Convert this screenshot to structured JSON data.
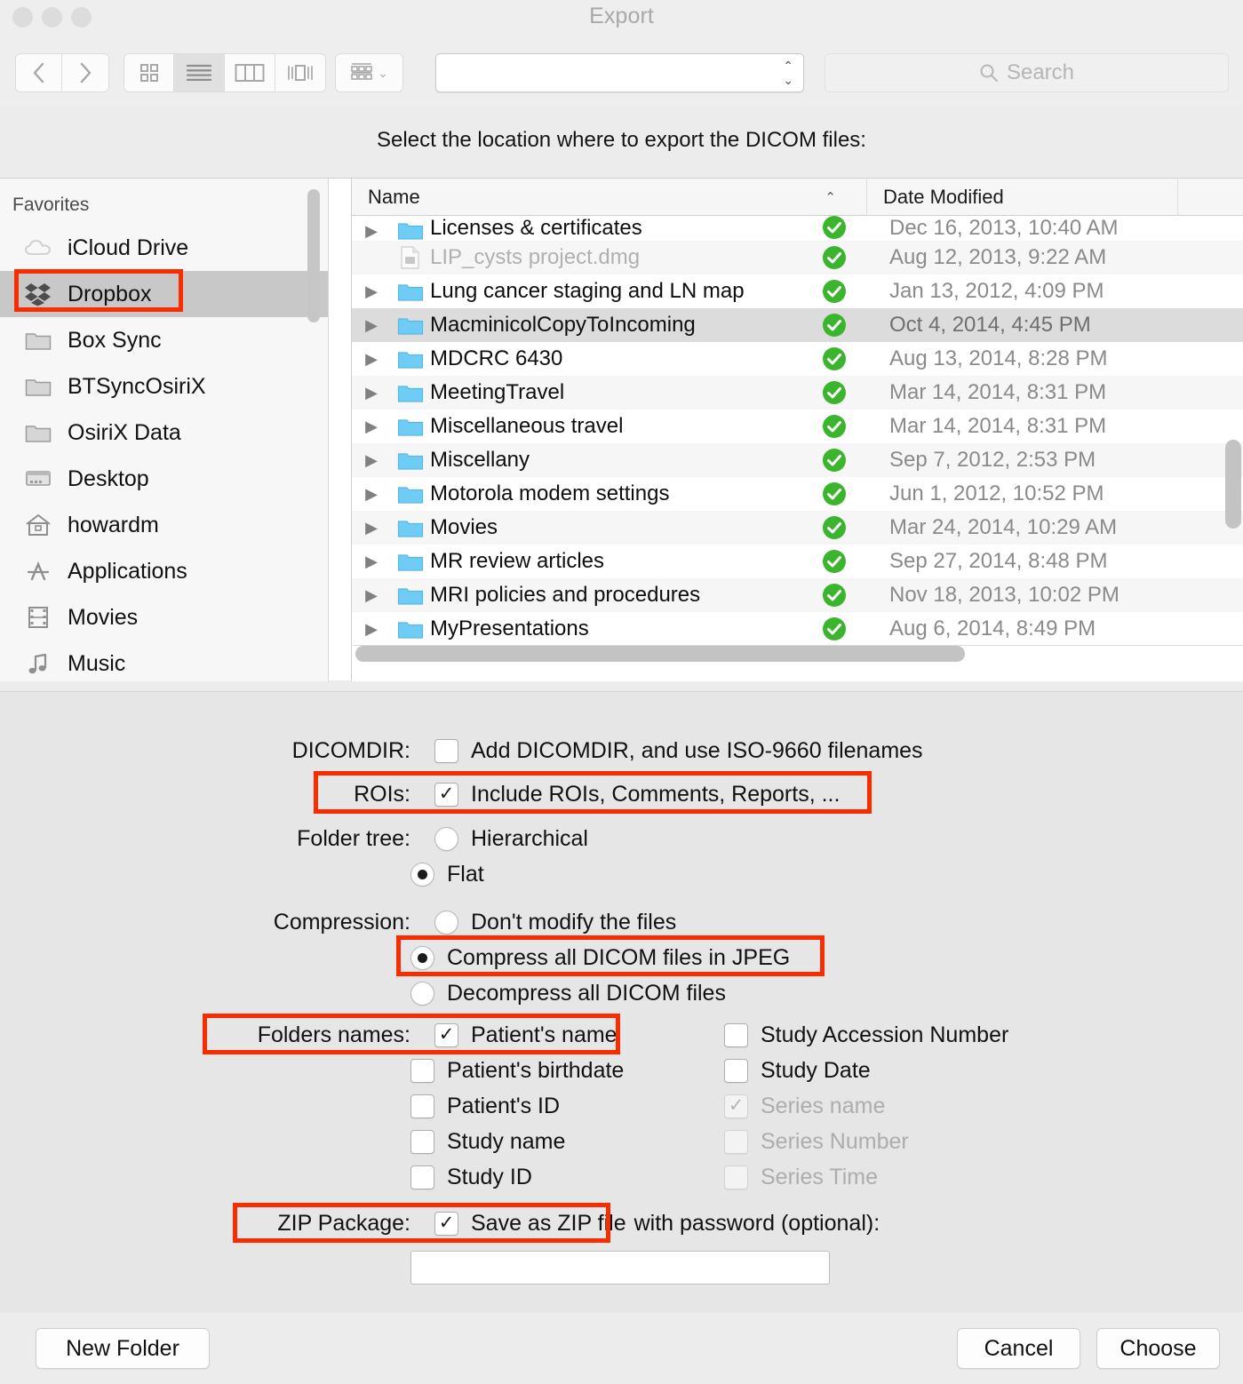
{
  "window": {
    "title": "Export"
  },
  "toolbar": {
    "back_icon": "back-chevron-icon",
    "forward_icon": "forward-chevron-icon",
    "view_icon_grid": "icon-view-icon",
    "view_list": "list-view-icon",
    "view_column": "column-view-icon",
    "view_coverflow": "coverflow-view-icon",
    "arrange_icon": "arrange-by-icon",
    "path_combo_value": "",
    "search_placeholder": "Search",
    "search_icon": "search-icon"
  },
  "prompt": {
    "text": "Select the location where to export the DICOM files:"
  },
  "sidebar": {
    "header": "Favorites",
    "items": [
      {
        "label": "iCloud Drive",
        "icon": "icloud-icon",
        "selected": false
      },
      {
        "label": "Dropbox",
        "icon": "dropbox-icon",
        "selected": true
      },
      {
        "label": "Box Sync",
        "icon": "folder-icon",
        "selected": false
      },
      {
        "label": "BTSyncOsiriX",
        "icon": "folder-icon",
        "selected": false
      },
      {
        "label": "OsiriX Data",
        "icon": "folder-icon",
        "selected": false
      },
      {
        "label": "Desktop",
        "icon": "desktop-icon",
        "selected": false
      },
      {
        "label": "howardm",
        "icon": "home-icon",
        "selected": false
      },
      {
        "label": "Applications",
        "icon": "applications-icon",
        "selected": false
      },
      {
        "label": "Movies",
        "icon": "movies-icon",
        "selected": false
      },
      {
        "label": "Music",
        "icon": "music-icon",
        "selected": false
      }
    ]
  },
  "filelist": {
    "columns": [
      "Name",
      "Date Modified"
    ],
    "sort_indicator": "sort-ascending-icon",
    "rows": [
      {
        "name": "Licenses & certificates",
        "date": "Dec 16, 2013, 10:40 AM",
        "icon": "folder-icon",
        "selected": false,
        "dim": false,
        "clipped": true
      },
      {
        "name": "LIP_cysts project.dmg",
        "date": "Aug 12, 2013, 9:22 AM",
        "icon": "disk-image-icon",
        "selected": false,
        "dim": true,
        "clipped": false
      },
      {
        "name": "Lung cancer staging and LN map",
        "date": "Jan 13, 2012, 4:09 PM",
        "icon": "folder-icon",
        "selected": false,
        "dim": false,
        "clipped": false
      },
      {
        "name": "MacminicolCopyToIncoming",
        "date": "Oct 4, 2014, 4:45 PM",
        "icon": "folder-icon",
        "selected": true,
        "dim": false,
        "clipped": false
      },
      {
        "name": "MDCRC 6430",
        "date": "Aug 13, 2014, 8:28 PM",
        "icon": "folder-icon",
        "selected": false,
        "dim": false,
        "clipped": false
      },
      {
        "name": "MeetingTravel",
        "date": "Mar 14, 2014, 8:31 PM",
        "icon": "folder-icon",
        "selected": false,
        "dim": false,
        "clipped": false
      },
      {
        "name": "Miscellaneous travel",
        "date": "Mar 14, 2014, 8:31 PM",
        "icon": "folder-icon",
        "selected": false,
        "dim": false,
        "clipped": false
      },
      {
        "name": "Miscellany",
        "date": "Sep 7, 2012, 2:53 PM",
        "icon": "folder-icon",
        "selected": false,
        "dim": false,
        "clipped": false
      },
      {
        "name": "Motorola modem settings",
        "date": "Jun 1, 2012, 10:52 PM",
        "icon": "folder-icon",
        "selected": false,
        "dim": false,
        "clipped": false
      },
      {
        "name": "Movies",
        "date": "Mar 24, 2014, 10:29 AM",
        "icon": "folder-icon",
        "selected": false,
        "dim": false,
        "clipped": false
      },
      {
        "name": "MR review articles",
        "date": "Sep 27, 2014, 8:48 PM",
        "icon": "folder-icon",
        "selected": false,
        "dim": false,
        "clipped": false
      },
      {
        "name": "MRI policies and procedures",
        "date": "Nov 18, 2013, 10:02 PM",
        "icon": "folder-icon",
        "selected": false,
        "dim": false,
        "clipped": false
      },
      {
        "name": "MyPresentations",
        "date": "Aug 6, 2014, 8:49 PM",
        "icon": "folder-icon",
        "selected": false,
        "dim": false,
        "clipped": false
      }
    ],
    "sync_badge_icon": "dropbox-synced-check-icon"
  },
  "options": {
    "dicomdir": {
      "label": "DICOMDIR:",
      "checkbox_label": "Add DICOMDIR, and use ISO-9660 filenames",
      "checked": false
    },
    "rois": {
      "label": "ROIs:",
      "checkbox_label": "Include ROIs, Comments, Reports, ...",
      "checked": true,
      "highlighted": true
    },
    "folder_tree": {
      "label": "Folder tree:",
      "options": [
        {
          "label": "Hierarchical",
          "selected": false
        },
        {
          "label": "Flat",
          "selected": true
        }
      ]
    },
    "compression": {
      "label": "Compression:",
      "options": [
        {
          "label": "Don't modify the files",
          "selected": false,
          "highlighted": false
        },
        {
          "label": "Compress all DICOM files in JPEG",
          "selected": true,
          "highlighted": true
        },
        {
          "label": "Decompress all DICOM files",
          "selected": false,
          "highlighted": false
        }
      ]
    },
    "folders_names": {
      "label": "Folders names:",
      "left_column": [
        {
          "label": "Patient's name",
          "checked": true,
          "disabled": false,
          "highlighted": true
        },
        {
          "label": "Patient's birthdate",
          "checked": false,
          "disabled": false,
          "highlighted": false
        },
        {
          "label": "Patient's ID",
          "checked": false,
          "disabled": false,
          "highlighted": false
        },
        {
          "label": "Study name",
          "checked": false,
          "disabled": false,
          "highlighted": false
        },
        {
          "label": "Study ID",
          "checked": false,
          "disabled": false,
          "highlighted": false
        }
      ],
      "right_column": [
        {
          "label": "Study Accession Number",
          "checked": false,
          "disabled": false
        },
        {
          "label": "Study Date",
          "checked": false,
          "disabled": false
        },
        {
          "label": "Series name",
          "checked": true,
          "disabled": true
        },
        {
          "label": "Series Number",
          "checked": false,
          "disabled": true
        },
        {
          "label": "Series Time",
          "checked": false,
          "disabled": true
        }
      ]
    },
    "zip_package": {
      "label": "ZIP Package:",
      "checkbox_label": "Save as ZIP file",
      "trailing_text": "with password (optional):",
      "checked": true,
      "highlighted": true,
      "password_value": "",
      "password_placeholder": ""
    }
  },
  "footer": {
    "new_folder": "New Folder",
    "cancel": "Cancel",
    "choose": "Choose"
  },
  "colors": {
    "highlight_red": "#f92c00",
    "selection_gray": "#c8c8c8",
    "sync_green": "#3cb52e",
    "folder_blue": "#6fcdf5"
  }
}
